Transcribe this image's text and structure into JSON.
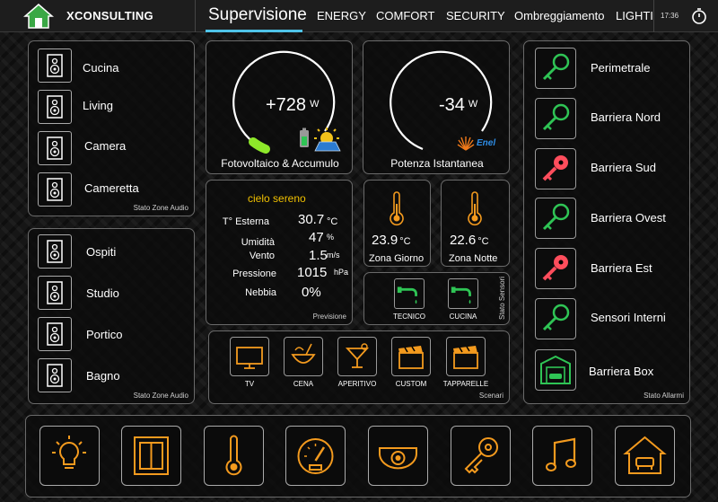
{
  "header": {
    "brand": "XCONSULTING",
    "tabs": [
      "Supervisione",
      "ENERGY",
      "COMFORT",
      "SECURITY",
      "Ombreggiamento",
      "LIGHTI"
    ],
    "clock": "17:36"
  },
  "audio1": {
    "zones": [
      "Cucina",
      "Living",
      "Camera",
      "Cameretta"
    ],
    "caption": "Stato Zone Audio"
  },
  "audio2": {
    "zones": [
      "Ospiti",
      "Studio",
      "Portico",
      "Bagno"
    ],
    "caption": "Stato Zone Audio"
  },
  "energy": {
    "pv_value": "+728",
    "pv_unit": "W",
    "pv_label": "Fotovoltaico & Accumulo",
    "grid_value": "-34",
    "grid_unit": "W",
    "grid_label": "Potenza Istantanea",
    "grid_logo": "Enel"
  },
  "weather": {
    "condition": "cielo sereno",
    "rows": [
      {
        "label": "T° Esterna",
        "value": "30.7",
        "unit": "°C"
      },
      {
        "label": "Umidità",
        "value": "47",
        "unit": "%"
      },
      {
        "label": "Vento",
        "value": "1.5",
        "unit": "m/s"
      },
      {
        "label": "Pressione",
        "value": "1015",
        "unit": "hPa"
      },
      {
        "label": "Nebbia",
        "value": "0%",
        "unit": ""
      }
    ],
    "caption": "Previsione"
  },
  "zones": {
    "day_value": "23.9",
    "day_unit": "°C",
    "day_label": "Zona Giorno",
    "night_value": "22.6",
    "night_unit": "°C",
    "night_label": "Zona Notte"
  },
  "sensors": {
    "items": [
      "TECNICO",
      "CUCINA"
    ],
    "caption": "Stato Sensori"
  },
  "scenes": {
    "items": [
      "TV",
      "CENA",
      "APERITIVO",
      "CUSTOM",
      "TAPPARELLE"
    ],
    "caption": "Scenari"
  },
  "alarms": {
    "items": [
      {
        "label": "Perimetrale",
        "state": "ok"
      },
      {
        "label": "Barriera Nord",
        "state": "ok"
      },
      {
        "label": "Barriera Sud",
        "state": "alarm"
      },
      {
        "label": "Barriera Ovest",
        "state": "ok"
      },
      {
        "label": "Barriera Est",
        "state": "alarm"
      },
      {
        "label": "Sensori Interni",
        "state": "ok"
      },
      {
        "label": "Barriera Box",
        "state": "garage"
      }
    ],
    "caption": "Stato Allarmi"
  },
  "nav_icons": [
    "bulb-icon",
    "window-icon",
    "thermometer-icon",
    "speedometer-icon",
    "camera-icon",
    "key-icon",
    "music-icon",
    "home-icon"
  ],
  "colors": {
    "accent": "#4fc3e8",
    "ok": "#2fc455",
    "alarm": "#ff4d5c",
    "orange": "#f39a1e",
    "pv_green": "#8ee82a",
    "weather_yellow": "#f0c000"
  }
}
